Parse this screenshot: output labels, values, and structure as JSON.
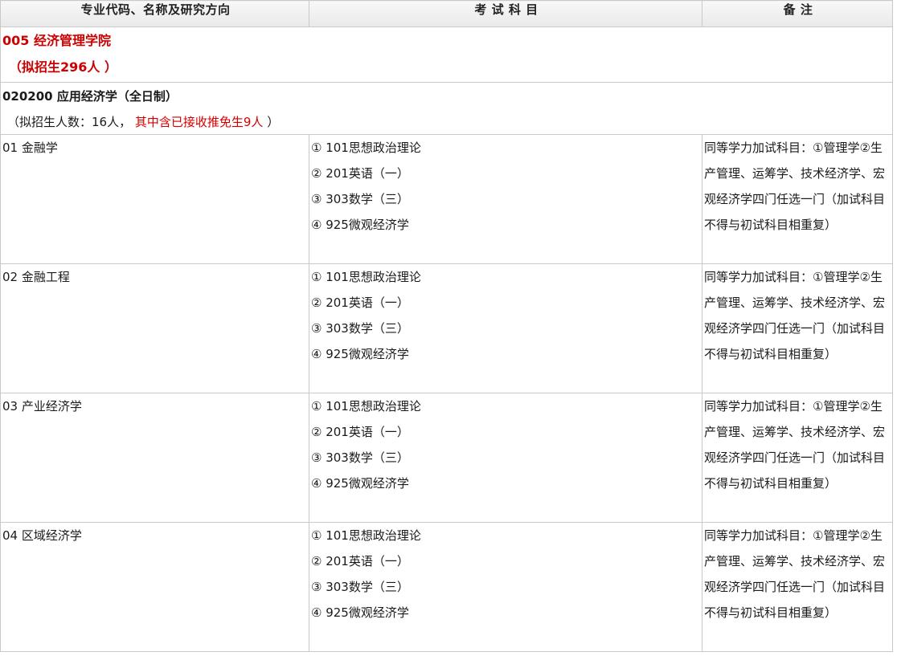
{
  "headers": [
    "专业代码、名称及研究方向",
    "考 试 科 目",
    "备 注"
  ],
  "school": {
    "name": "005 经济管理学院",
    "quota": "（拟招生296人 ）"
  },
  "major": {
    "name": "020200 应用经济学（全日制）",
    "quota_prefix": "（拟招生人数：16人，",
    "quota_red": "其中含已接收推免生9人",
    "quota_suffix": "）"
  },
  "directions": [
    {
      "name": "01 金融学",
      "subjects": [
        "① 101思想政治理论",
        "② 201英语（一）",
        "③ 303数学（三）",
        "④ 925微观经济学"
      ],
      "note": "同等学力加试科目：①管理学②生产管理、运筹学、技术经济学、宏观经济学四门任选一门（加试科目不得与初试科目相重复）"
    },
    {
      "name": "02 金融工程",
      "subjects": [
        "① 101思想政治理论",
        "② 201英语（一）",
        "③ 303数学（三）",
        "④ 925微观经济学"
      ],
      "note": "同等学力加试科目：①管理学②生产管理、运筹学、技术经济学、宏观经济学四门任选一门（加试科目不得与初试科目相重复）"
    },
    {
      "name": "03 产业经济学",
      "subjects": [
        "① 101思想政治理论",
        "② 201英语（一）",
        "③ 303数学（三）",
        "④ 925微观经济学"
      ],
      "note": "同等学力加试科目：①管理学②生产管理、运筹学、技术经济学、宏观经济学四门任选一门（加试科目不得与初试科目相重复）"
    },
    {
      "name": "04 区域经济学",
      "subjects": [
        "① 101思想政治理论",
        "② 201英语（一）",
        "③ 303数学（三）",
        "④ 925微观经济学"
      ],
      "note": "同等学力加试科目：①管理学②生产管理、运筹学、技术经济学、宏观经济学四门任选一门（加试科目不得与初试科目相重复）"
    }
  ]
}
